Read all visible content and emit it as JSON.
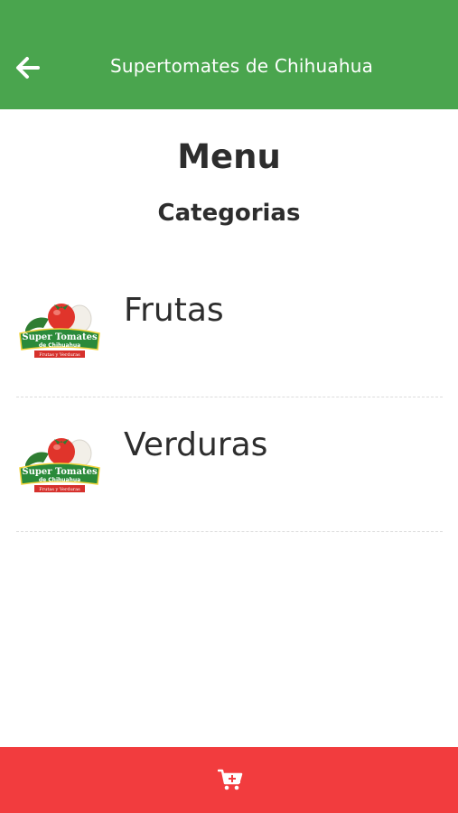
{
  "header": {
    "title": "Supertomates de Chihuahua",
    "back_icon": "arrow-left-icon",
    "background_color": "#4aa54e"
  },
  "main": {
    "title": "Menu",
    "subtitle": "Categorias",
    "categories": [
      {
        "label": "Frutas",
        "logo": "super-tomates-logo"
      },
      {
        "label": "Verduras",
        "logo": "super-tomates-logo"
      }
    ],
    "logo_text": {
      "line1": "Super Tomates",
      "line2": "de Chihuahua",
      "line3": "Frutas y Verduras"
    }
  },
  "bottom_bar": {
    "icon": "cart-plus-icon",
    "background_color": "#f23c3e"
  }
}
